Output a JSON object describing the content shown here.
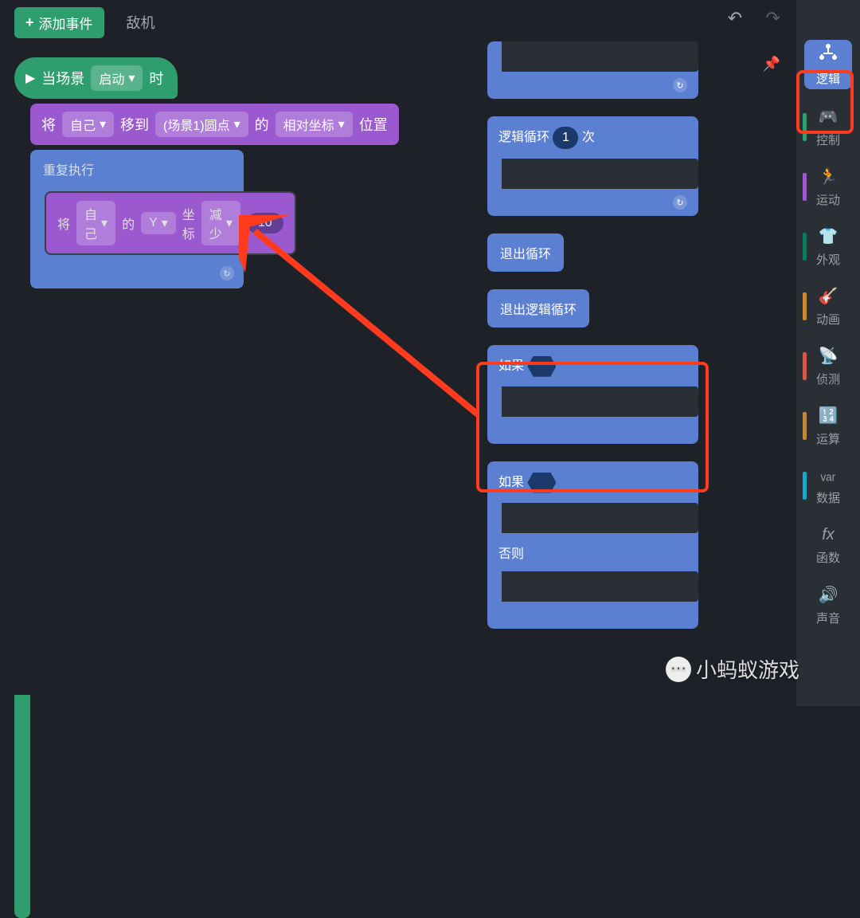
{
  "toolbar": {
    "add_event": "添加事件",
    "sprite_name": "敌机"
  },
  "rail": {
    "logic": "逻辑",
    "items": [
      {
        "label": "控制"
      },
      {
        "label": "运动"
      },
      {
        "label": "外观"
      },
      {
        "label": "动画"
      },
      {
        "label": "侦测"
      },
      {
        "label": "运算"
      },
      {
        "label": "数据"
      },
      {
        "label": "函数"
      },
      {
        "label": "声音"
      }
    ]
  },
  "blocks": {
    "hat": {
      "pre": "当场景",
      "drop": "启动",
      "post": "时"
    },
    "move": {
      "pre": "将",
      "target": "自己",
      "mid": "移到",
      "scene": "(场景1)圆点",
      "of": "的",
      "coord": "相对坐标",
      "post": "位置"
    },
    "repeat": "重复执行",
    "change": {
      "pre": "将",
      "target": "自己",
      "of": "的",
      "axis": "Y",
      "coord": "坐标",
      "op": "减少",
      "val": "10"
    }
  },
  "palette": {
    "logic_loop_pre": "逻辑循环",
    "logic_loop_val": "1",
    "logic_loop_post": "次",
    "exit_loop": "退出循环",
    "exit_logic_loop": "退出逻辑循环",
    "if": "如果",
    "else": "否则"
  },
  "watermark": "小蚂蚁游戏"
}
